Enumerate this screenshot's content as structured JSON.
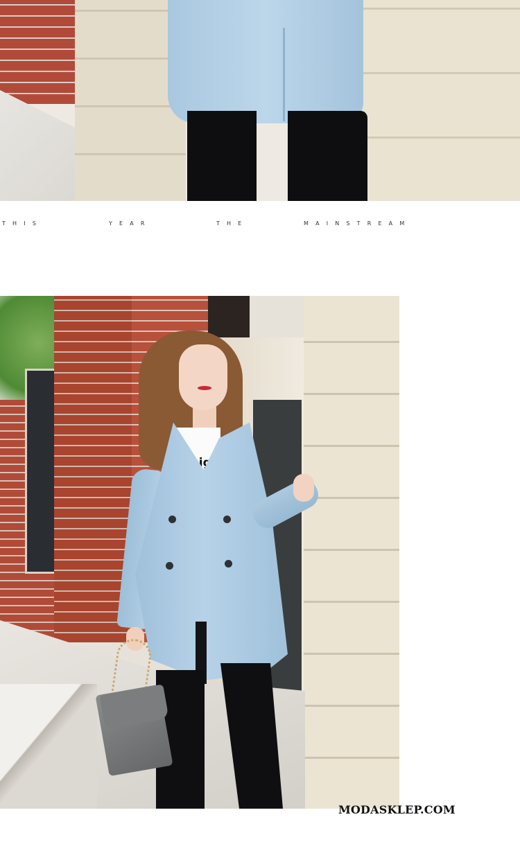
{
  "tagline_words": [
    {
      "key": "this",
      "letters": "T H I S"
    },
    {
      "key": "year",
      "letters": "Y E A R"
    },
    {
      "key": "the",
      "letters": "T H E"
    },
    {
      "key": "mainstream",
      "letters": "M A I N S T R E A M"
    }
  ],
  "tagline": {
    "this": "T    H    I    S",
    "year": "Y    E    A    R",
    "the": "T    H    E",
    "mainstream": "M    A    I    N    S    T    R    E    A    M"
  },
  "shirt_print": "onigh",
  "brand": "MODASKLEP.COM",
  "colors": {
    "coat": "#aecce3",
    "pants": "#0f0f12",
    "brick": "#b24a3a",
    "stone": "#ebe3d2",
    "background": "#ffffff"
  }
}
